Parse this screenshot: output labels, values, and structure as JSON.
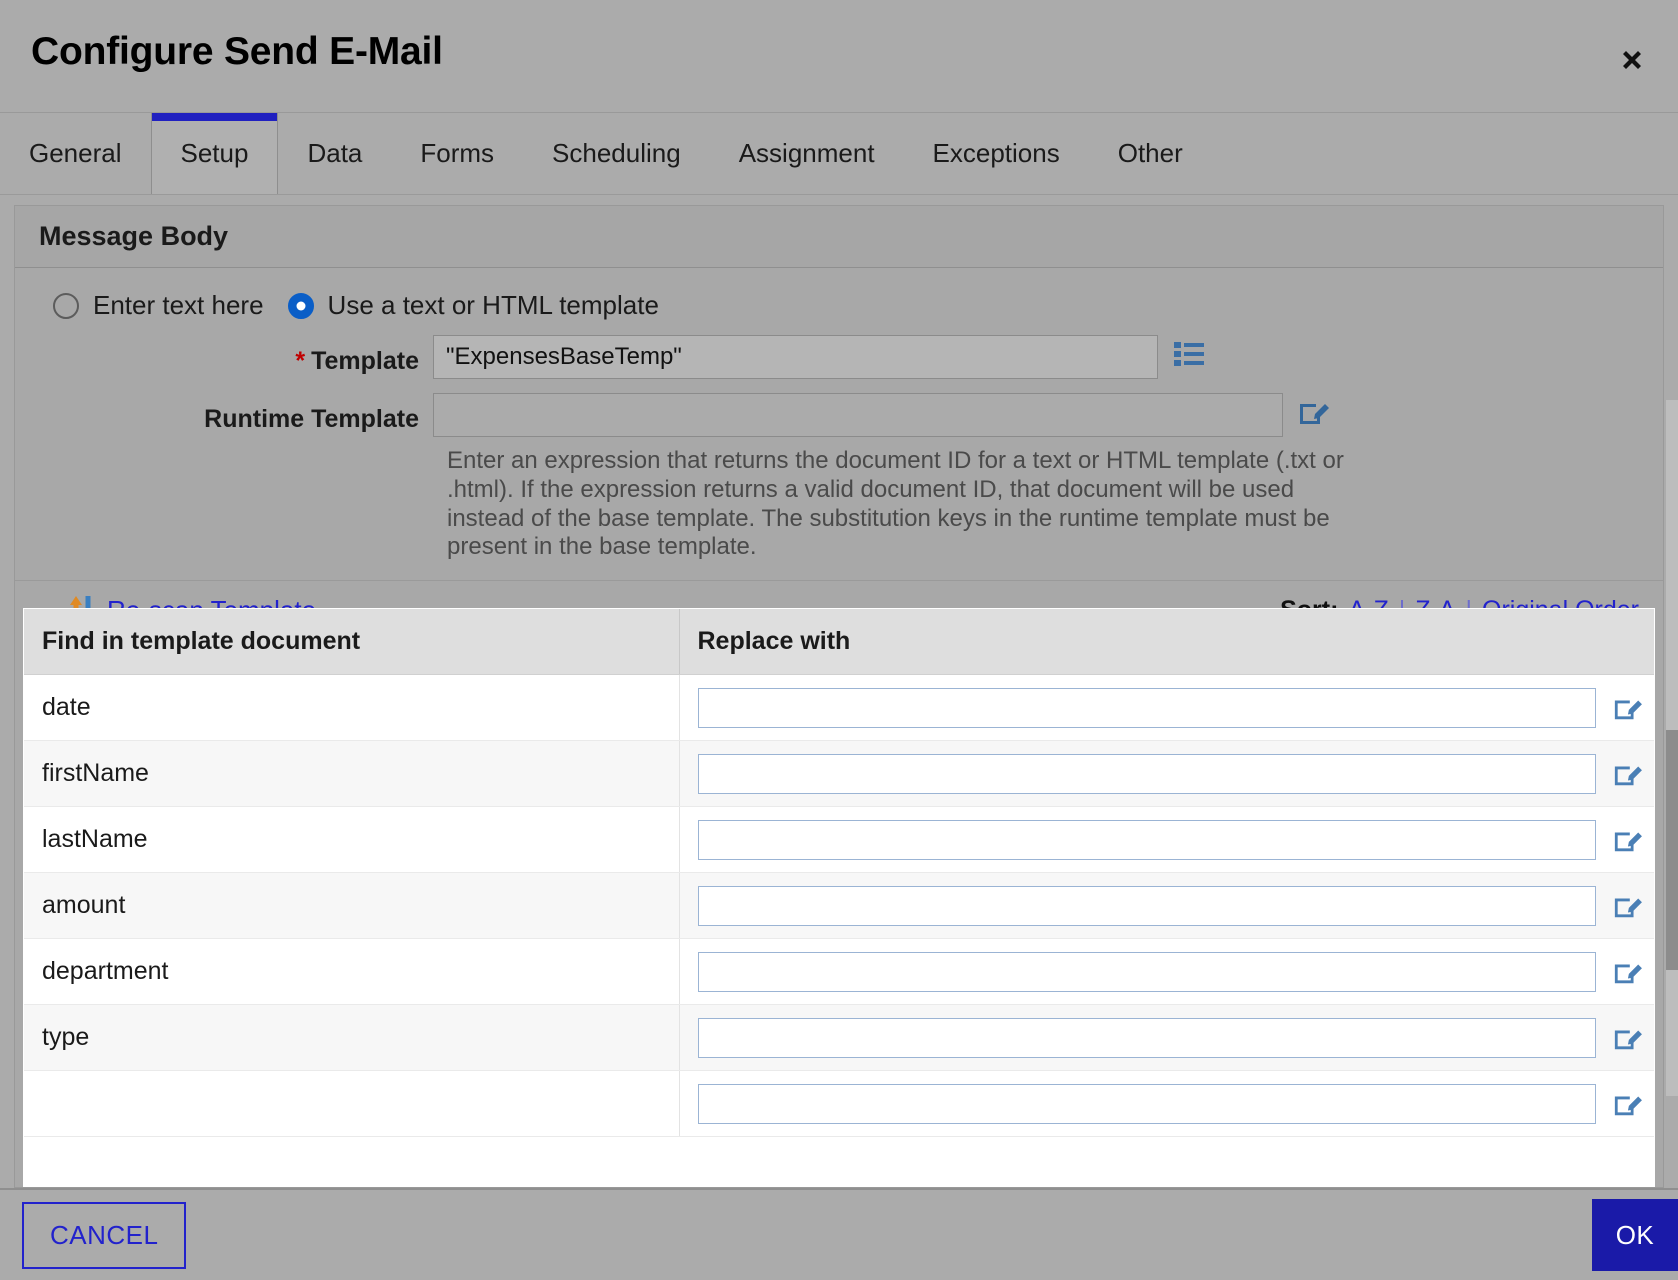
{
  "dialog": {
    "title": "Configure Send E-Mail",
    "close_icon": "close-icon"
  },
  "tabs": [
    {
      "label": "General",
      "active": false
    },
    {
      "label": "Setup",
      "active": true
    },
    {
      "label": "Data",
      "active": false
    },
    {
      "label": "Forms",
      "active": false
    },
    {
      "label": "Scheduling",
      "active": false
    },
    {
      "label": "Assignment",
      "active": false
    },
    {
      "label": "Exceptions",
      "active": false
    },
    {
      "label": "Other",
      "active": false
    }
  ],
  "section": {
    "header": "Message Body"
  },
  "message_body": {
    "radio_enter_text": {
      "label": "Enter text here",
      "selected": false
    },
    "radio_use_template": {
      "label": "Use a text or HTML template",
      "selected": true
    },
    "template": {
      "label": "Template",
      "required_marker": "*",
      "value": "\"ExpensesBaseTemp\"",
      "placeholder": "",
      "picker_icon": "list-icon"
    },
    "runtime_template": {
      "label": "Runtime Template",
      "value": "",
      "placeholder": "",
      "edit_icon": "edit-pencil-icon"
    },
    "help_text": "Enter an expression that returns the document ID for a text or HTML template (.txt or .html). If the expression returns a valid document ID, that document will be used instead of the base template. The substitution keys in the runtime template must be present in the base template."
  },
  "toolbar": {
    "rescan_label": "Re-scan Template",
    "rescan_icon": "refresh-arrows-icon",
    "sort_label": "Sort:",
    "sort_options": [
      "A-Z",
      "Z-A",
      "Original Order"
    ],
    "sort_separator": "|"
  },
  "table": {
    "columns": [
      "Find in template document",
      "Replace with"
    ],
    "rows": [
      {
        "find": "date",
        "replace": "",
        "edit_icon": "edit-pencil-icon"
      },
      {
        "find": "firstName",
        "replace": "",
        "edit_icon": "edit-pencil-icon"
      },
      {
        "find": "lastName",
        "replace": "",
        "edit_icon": "edit-pencil-icon"
      },
      {
        "find": "amount",
        "replace": "",
        "edit_icon": "edit-pencil-icon"
      },
      {
        "find": "department",
        "replace": "",
        "edit_icon": "edit-pencil-icon"
      },
      {
        "find": "type",
        "replace": "",
        "edit_icon": "edit-pencil-icon"
      },
      {
        "find": "",
        "replace": "",
        "edit_icon": "edit-pencil-icon"
      }
    ]
  },
  "footer": {
    "cancel_label": "CANCEL",
    "ok_label": "OK"
  },
  "colors": {
    "accent_blue": "#2222cc",
    "tab_active_bar": "#2020c0",
    "ok_button": "#1a1aa8",
    "required_star": "#c00000",
    "dialog_bg": "#ababab",
    "table_header_bg": "#dedede",
    "input_border": "#9bb4d4"
  }
}
